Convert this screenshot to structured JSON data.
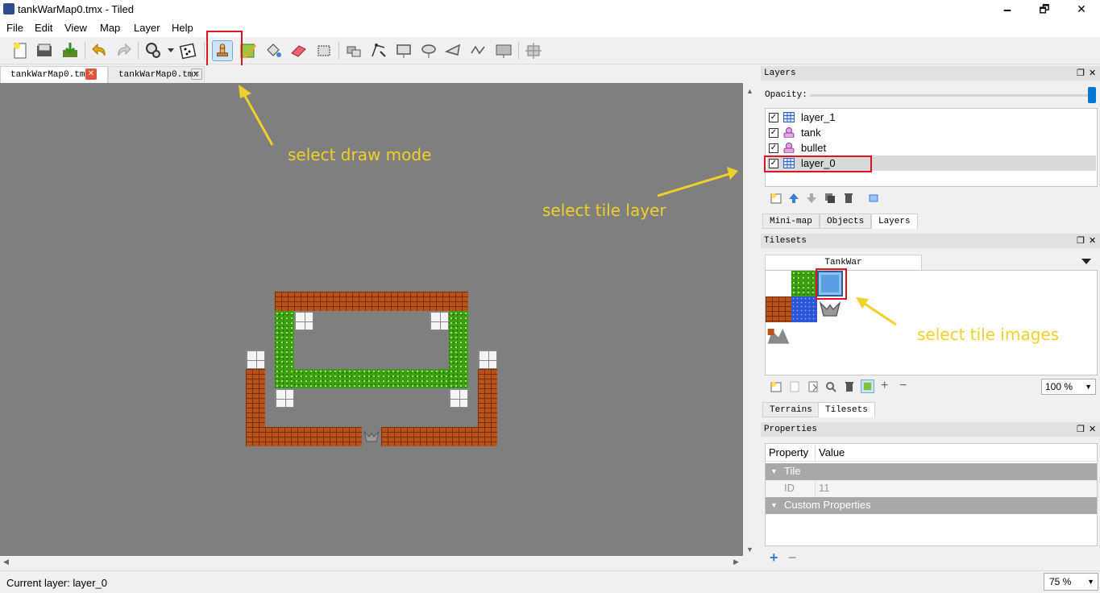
{
  "window": {
    "title": "tankWarMap0.tmx - Tiled",
    "minimize": "🗕",
    "maximize": "🗗",
    "close": "✕"
  },
  "menu": [
    "File",
    "Edit",
    "View",
    "Map",
    "Layer",
    "Help"
  ],
  "tabs": [
    {
      "label": "tankWarMap0.tmx",
      "active": true
    },
    {
      "label": "tankWarMap0.tmx",
      "active": false
    }
  ],
  "annotations": {
    "draw_mode": "select draw mode",
    "tile_layer": "select tile layer",
    "tile_images": "select tile images"
  },
  "layers_panel": {
    "title": "Layers",
    "opacity_label": "Opacity:",
    "layers": [
      {
        "name": "layer_1",
        "type": "tile",
        "visible": true
      },
      {
        "name": "tank",
        "type": "object",
        "visible": true
      },
      {
        "name": "bullet",
        "type": "object",
        "visible": true
      },
      {
        "name": "layer_0",
        "type": "tile",
        "visible": true,
        "selected": true
      }
    ],
    "tabs": [
      "Mini-map",
      "Objects",
      "Layers"
    ],
    "active_tab": "Layers"
  },
  "tilesets_panel": {
    "title": "Tilesets",
    "tileset_tab": "TankWar",
    "zoom": "100 %",
    "tabs": [
      "Terrains",
      "Tilesets"
    ],
    "active_tab": "Tilesets"
  },
  "properties_panel": {
    "title": "Properties",
    "col_property": "Property",
    "col_value": "Value",
    "group_tile": "Tile",
    "id_label": "ID",
    "id_value": "11",
    "group_custom": "Custom Properties"
  },
  "status": {
    "current_layer": "Current layer: layer_0",
    "zoom": "75 %"
  },
  "colors": {
    "annotation": "#f0d12a",
    "highlight": "#e0141e",
    "canvas": "#7f7f7f"
  }
}
